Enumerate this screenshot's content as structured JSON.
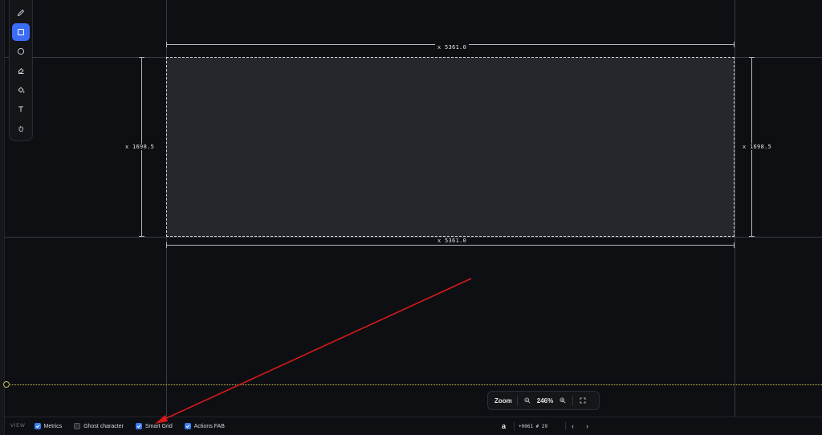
{
  "canvas": {
    "width_label": "x 5361.0",
    "height_label": "x 1698.5"
  },
  "zoom": {
    "label": "Zoom",
    "value": "246%"
  },
  "statusbar": {
    "view_label": "VIEW",
    "options": [
      {
        "label": "Metrics",
        "checked": true
      },
      {
        "label": "Ghost character",
        "checked": false
      },
      {
        "label": "Smart Grid",
        "checked": true
      },
      {
        "label": "Actions FAB",
        "checked": true
      }
    ],
    "char_preview": "a",
    "codepoint": "+0061  # 29",
    "prev": "‹",
    "next": "›"
  },
  "toolbar": {
    "tools": [
      "pencil-icon",
      "rectangle-icon",
      "circle-icon",
      "eraser-icon",
      "fill-bucket-icon",
      "text-icon",
      "hand-icon"
    ],
    "active": "rectangle-icon"
  },
  "colors": {
    "accent": "#3b6cf6",
    "baseline": "#c9c35a",
    "annotation": "#d61a1a"
  }
}
